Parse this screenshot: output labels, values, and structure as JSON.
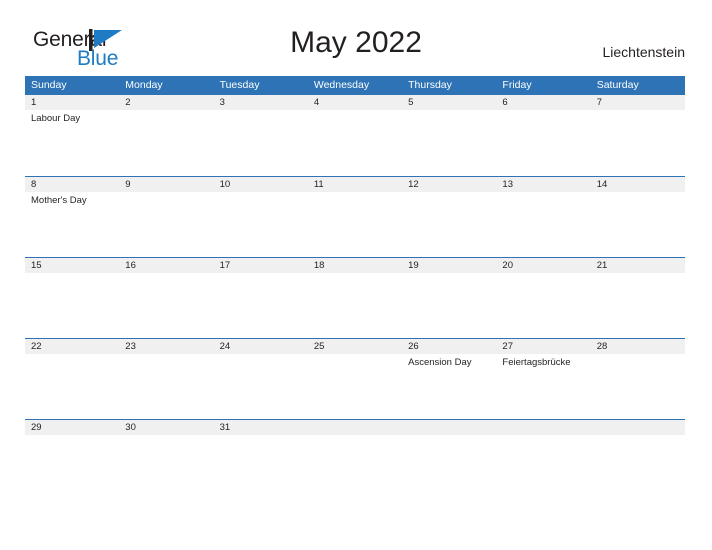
{
  "brand": {
    "name_part1": "General",
    "name_part2": "Blue",
    "logo_icon": "general-blue-flag-logo",
    "accent_color": "#1f7cc4"
  },
  "header": {
    "title": "May 2022",
    "location": "Liechtenstein"
  },
  "theme": {
    "header_blue": "#2d73b5",
    "daynum_band": "#f0f0f0",
    "text": "#231f20"
  },
  "calendar": {
    "weekdays": [
      "Sunday",
      "Monday",
      "Tuesday",
      "Wednesday",
      "Thursday",
      "Friday",
      "Saturday"
    ],
    "weeks": [
      {
        "days": [
          {
            "num": "1",
            "events": [
              "Labour Day"
            ]
          },
          {
            "num": "2",
            "events": []
          },
          {
            "num": "3",
            "events": []
          },
          {
            "num": "4",
            "events": []
          },
          {
            "num": "5",
            "events": []
          },
          {
            "num": "6",
            "events": []
          },
          {
            "num": "7",
            "events": []
          }
        ]
      },
      {
        "days": [
          {
            "num": "8",
            "events": [
              "Mother's Day"
            ]
          },
          {
            "num": "9",
            "events": []
          },
          {
            "num": "10",
            "events": []
          },
          {
            "num": "11",
            "events": []
          },
          {
            "num": "12",
            "events": []
          },
          {
            "num": "13",
            "events": []
          },
          {
            "num": "14",
            "events": []
          }
        ]
      },
      {
        "days": [
          {
            "num": "15",
            "events": []
          },
          {
            "num": "16",
            "events": []
          },
          {
            "num": "17",
            "events": []
          },
          {
            "num": "18",
            "events": []
          },
          {
            "num": "19",
            "events": []
          },
          {
            "num": "20",
            "events": []
          },
          {
            "num": "21",
            "events": []
          }
        ]
      },
      {
        "days": [
          {
            "num": "22",
            "events": []
          },
          {
            "num": "23",
            "events": []
          },
          {
            "num": "24",
            "events": []
          },
          {
            "num": "25",
            "events": []
          },
          {
            "num": "26",
            "events": [
              "Ascension Day"
            ]
          },
          {
            "num": "27",
            "events": [
              "Feiertagsbrücke"
            ]
          },
          {
            "num": "28",
            "events": []
          }
        ]
      },
      {
        "days": [
          {
            "num": "29",
            "events": []
          },
          {
            "num": "30",
            "events": []
          },
          {
            "num": "31",
            "events": []
          },
          {
            "num": "",
            "events": []
          },
          {
            "num": "",
            "events": []
          },
          {
            "num": "",
            "events": []
          },
          {
            "num": "",
            "events": []
          }
        ]
      }
    ]
  }
}
